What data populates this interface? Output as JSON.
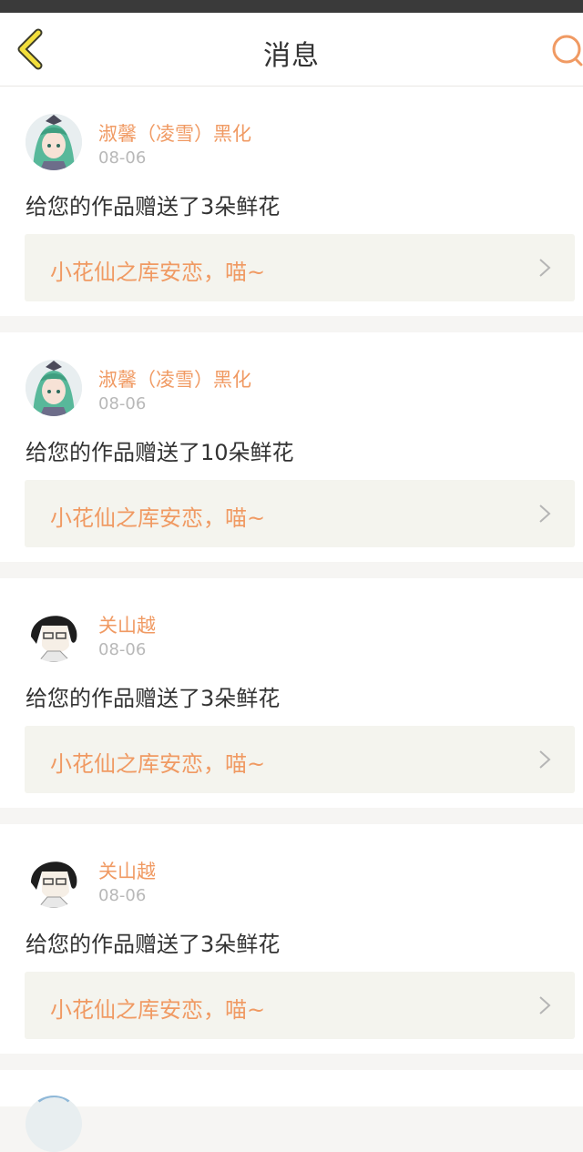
{
  "header": {
    "title": "消息",
    "back_icon": "back-chevron-icon",
    "search_icon": "search-icon",
    "accent_color": "#f09a63"
  },
  "messages": [
    {
      "user": "淑馨（凌雪）黑化",
      "date": "08-06",
      "text": "给您的作品赠送了3朵鲜花",
      "work": "小花仙之库安恋，喵~",
      "avatar": "green-hair-girl-avatar"
    },
    {
      "user": "淑馨（凌雪）黑化",
      "date": "08-06",
      "text": "给您的作品赠送了10朵鲜花",
      "work": "小花仙之库安恋，喵~",
      "avatar": "green-hair-girl-avatar"
    },
    {
      "user": "关山越",
      "date": "08-06",
      "text": "给您的作品赠送了3朵鲜花",
      "work": "小花仙之库安恋，喵~",
      "avatar": "glasses-boy-avatar"
    },
    {
      "user": "关山越",
      "date": "08-06",
      "text": "给您的作品赠送了3朵鲜花",
      "work": "小花仙之库安恋，喵~",
      "avatar": "glasses-boy-avatar"
    }
  ]
}
